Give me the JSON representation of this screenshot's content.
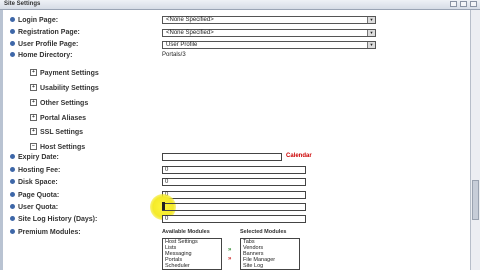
{
  "window": {
    "title": "Site Settings"
  },
  "fields": {
    "login_page": {
      "label": "Login Page:",
      "value": "<None Specified>"
    },
    "registration_page": {
      "label": "Registration Page:",
      "value": "<None Specified>"
    },
    "user_profile_page": {
      "label": "User Profile Page:",
      "value": "User Profile"
    },
    "home_directory": {
      "label": "Home Directory:",
      "value": "Portals/3"
    }
  },
  "sections": {
    "payment": "Payment Settings",
    "usability": "Usability Settings",
    "other": "Other Settings",
    "portal_aliases": "Portal Aliases",
    "ssl": "SSL Settings",
    "host": "Host Settings"
  },
  "host": {
    "expiry_date": {
      "label": "Expiry Date:",
      "value": "",
      "calendar_link": "Calendar"
    },
    "hosting_fee": {
      "label": "Hosting Fee:",
      "value": "0"
    },
    "disk_space": {
      "label": "Disk Space:",
      "value": "0"
    },
    "page_quota": {
      "label": "Page Quota:",
      "value": "0"
    },
    "user_quota": {
      "label": "User Quota:",
      "value": ""
    },
    "site_log_history": {
      "label": "Site Log History (Days):",
      "value": "0"
    },
    "premium_modules": {
      "label": "Premium Modules:",
      "available_header": "Available Modules",
      "selected_header": "Selected Modules",
      "available": [
        "Host Settings",
        "Lists",
        "Messaging",
        "Portals",
        "Scheduler"
      ],
      "selected": [
        "Tabs",
        "Vendors",
        "Banners",
        "File Manager",
        "Site Log"
      ],
      "add_arrow": "»",
      "remove_arrow": "»"
    }
  },
  "colors": {
    "help_icon": "#3e67a8",
    "calendar_link": "#cc0000",
    "highlight": "#f4ea2a"
  }
}
